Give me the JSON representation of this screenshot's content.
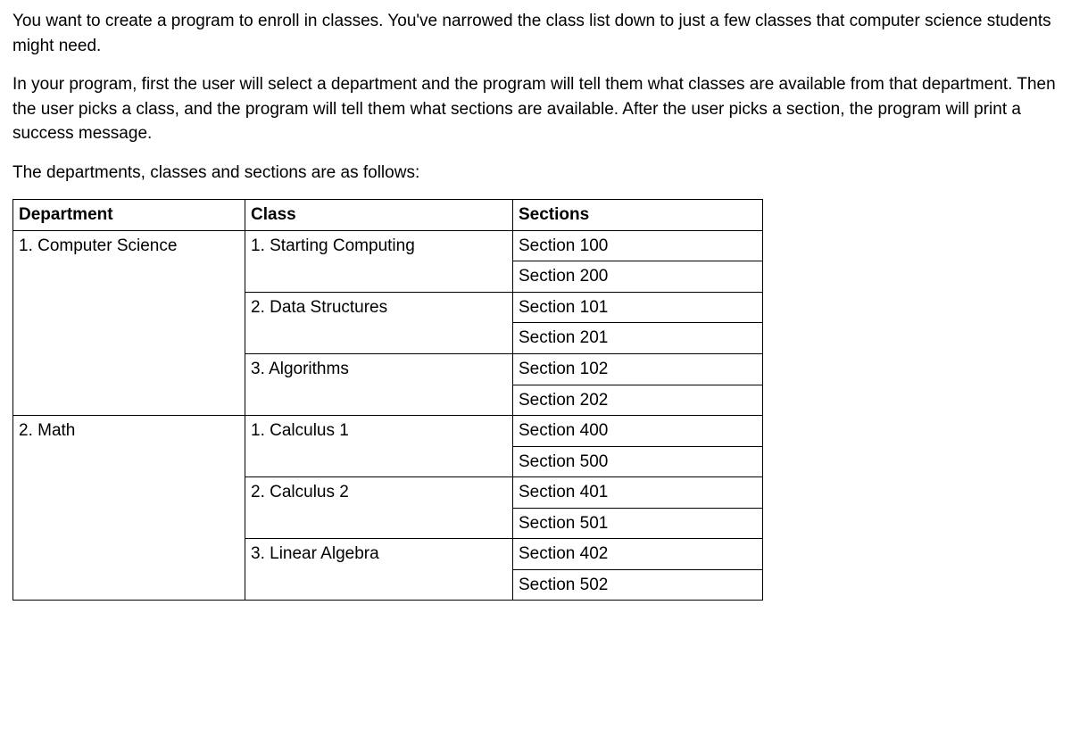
{
  "paragraphs": {
    "p1": "You want to create a program to enroll in classes. You've narrowed the class list down to just a few classes that computer science students might need.",
    "p2": "In your program, first the user will select a department and the program will tell them what classes are available from that department. Then the user picks a class, and the program will tell them what sections are available. After the user picks a section, the program will print a success message.",
    "p3": "The departments, classes and sections are as follows:"
  },
  "table": {
    "headers": {
      "department": "Department",
      "class": "Class",
      "sections": "Sections"
    },
    "rows": [
      {
        "department": "1. Computer Science",
        "class": "1. Starting Computing",
        "section": "Section 100"
      },
      {
        "department": "",
        "class": "",
        "section": "Section 200"
      },
      {
        "department": "",
        "class": "2. Data Structures",
        "section": "Section 101"
      },
      {
        "department": "",
        "class": "",
        "section": "Section 201"
      },
      {
        "department": "",
        "class": "3. Algorithms",
        "section": "Section 102"
      },
      {
        "department": "",
        "class": "",
        "section": "Section 202"
      },
      {
        "department": "2. Math",
        "class": "1. Calculus 1",
        "section": "Section 400"
      },
      {
        "department": "",
        "class": "",
        "section": "Section 500"
      },
      {
        "department": "",
        "class": "2. Calculus 2",
        "section": "Section 401"
      },
      {
        "department": "",
        "class": "",
        "section": "Section 501"
      },
      {
        "department": "",
        "class": "3. Linear Algebra",
        "section": "Section 402"
      },
      {
        "department": "",
        "class": "",
        "section": "Section 502"
      }
    ]
  }
}
